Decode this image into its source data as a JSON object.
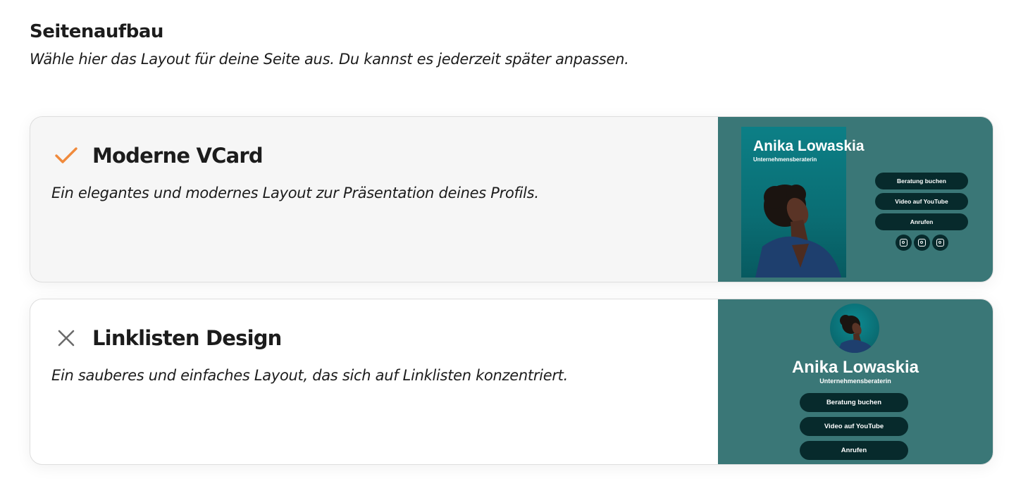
{
  "section": {
    "title": "Seitenaufbau",
    "subtitle": "Wähle hier das Layout für deine Seite aus. Du kannst es jederzeit später anpassen."
  },
  "layouts": [
    {
      "title": "Moderne VCard",
      "description": "Ein elegantes und modernes Layout zur Präsentation deines Profils.",
      "selected": true,
      "status_icon": "check-icon",
      "preview": {
        "name": "Anika Lowaskia",
        "role": "Unternehmensberaterin",
        "buttons": [
          "Beratung buchen",
          "Video auf YouTube",
          "Anrufen"
        ],
        "social_icons": [
          "instagram-icon",
          "instagram-icon",
          "instagram-icon"
        ]
      }
    },
    {
      "title": "Linklisten Design",
      "description": "Ein sauberes und einfaches Layout, das sich auf Linklisten konzentriert.",
      "selected": false,
      "status_icon": "close-icon",
      "preview": {
        "name": "Anika Lowaskia",
        "role": "Unternehmensberaterin",
        "buttons": [
          "Beratung buchen",
          "Video auf YouTube",
          "Anrufen"
        ]
      }
    }
  ],
  "colors": {
    "accent_check": "#f08a3c",
    "close_icon": "#6b6b6b",
    "preview_bg": "#3a7777",
    "preview_button": "#072a2c",
    "selected_card_bg": "#f6f6f6"
  }
}
